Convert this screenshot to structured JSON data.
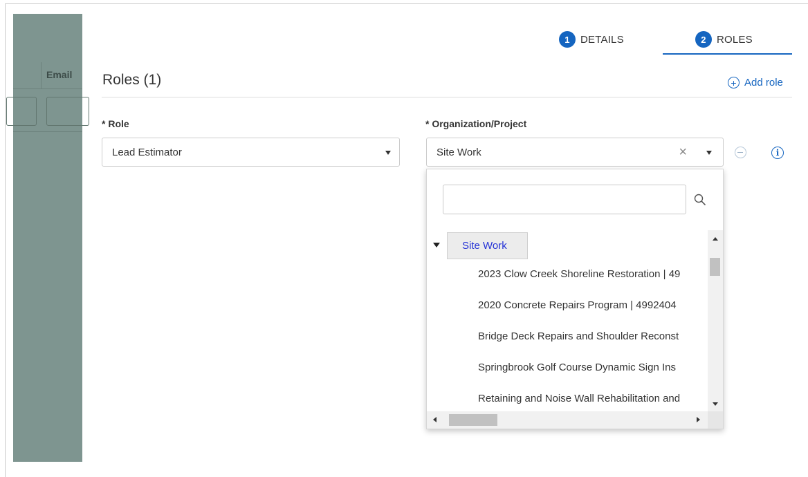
{
  "background_table": {
    "column_header": "Email"
  },
  "stepper": {
    "steps": [
      {
        "number": "1",
        "label": "DETAILS"
      },
      {
        "number": "2",
        "label": "ROLES"
      }
    ],
    "active_step": "ROLES"
  },
  "roles_section": {
    "title": "Roles (1)",
    "add_role_label": "Add role"
  },
  "role_row": {
    "role_label": "* Role",
    "role_value": "Lead Estimator",
    "org_label": "* Organization/Project",
    "org_value": "Site Work"
  },
  "dropdown": {
    "search_value": "",
    "tree_root": "Site Work",
    "tree_children": [
      "2023 Clow Creek Shoreline Restoration | 49",
      "2020 Concrete Repairs Program | 4992404",
      "Bridge Deck Repairs and Shoulder Reconst",
      "Springbrook Golf Course Dynamic Sign Ins",
      "Retaining and Noise Wall Rehabilitation and"
    ]
  },
  "colors": {
    "accent": "#1565c0",
    "overlay_panel": "#7e9590",
    "tree_root_text": "#2533d6"
  }
}
